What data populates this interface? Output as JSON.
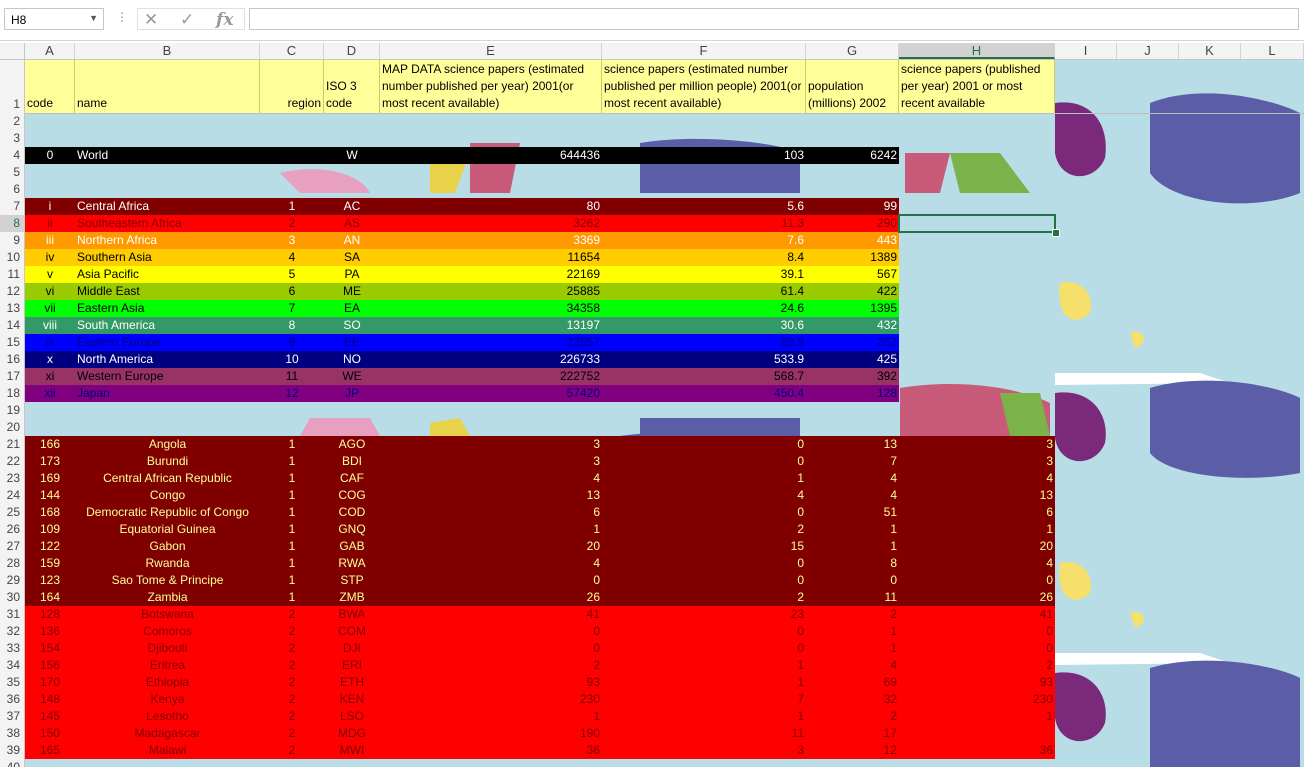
{
  "namebox": {
    "value": "H8"
  },
  "formula": {
    "value": ""
  },
  "columns": [
    "A",
    "B",
    "C",
    "D",
    "E",
    "F",
    "G",
    "H",
    "I",
    "J",
    "K",
    "L"
  ],
  "selected_column": "H",
  "selected_row": 8,
  "header_row": {
    "row": 1,
    "code": "code",
    "name": "name",
    "region": "region",
    "iso": "ISO 3 code",
    "map_data": "MAP DATA science papers (estimated number published per year) 2001(or most recent available)",
    "per_million": "science papers (estimated number published per million people) 2001(or most recent available)",
    "population": "population (millions) 2002",
    "papers": "science papers (published per year) 2001 or most recent available"
  },
  "world_row": {
    "row": 4,
    "code": "0",
    "name": "World",
    "iso": "W",
    "map_data": "644436",
    "per_million": "103",
    "population": "6242"
  },
  "regions": [
    {
      "row": 7,
      "code": "i",
      "name": "Central Africa",
      "region": "1",
      "iso": "AC",
      "map_data": "80",
      "per_million": "5.6",
      "population": "99",
      "bg": "#800000",
      "fg": "#ffffff"
    },
    {
      "row": 8,
      "code": "ii",
      "name": "Southeastern Africa",
      "region": "2",
      "iso": "AS",
      "map_data": "3262",
      "per_million": "11.3",
      "population": "290",
      "bg": "#ff0000",
      "fg": "#800000"
    },
    {
      "row": 9,
      "code": "iii",
      "name": "Northern Africa",
      "region": "3",
      "iso": "AN",
      "map_data": "3369",
      "per_million": "7.6",
      "population": "443",
      "bg": "#ff9900",
      "fg": "#ffffff"
    },
    {
      "row": 10,
      "code": "iv",
      "name": "Southern Asia",
      "region": "4",
      "iso": "SA",
      "map_data": "11654",
      "per_million": "8.4",
      "population": "1389",
      "bg": "#ffcc00",
      "fg": "#000000"
    },
    {
      "row": 11,
      "code": "v",
      "name": "Asia Pacific",
      "region": "5",
      "iso": "PA",
      "map_data": "22169",
      "per_million": "39.1",
      "population": "567",
      "bg": "#ffff00",
      "fg": "#000000"
    },
    {
      "row": 12,
      "code": "vi",
      "name": "Middle East",
      "region": "6",
      "iso": "ME",
      "map_data": "25885",
      "per_million": "61.4",
      "population": "422",
      "bg": "#99cc00",
      "fg": "#000000"
    },
    {
      "row": 13,
      "code": "vii",
      "name": "Eastern Asia",
      "region": "7",
      "iso": "EA",
      "map_data": "34358",
      "per_million": "24.6",
      "population": "1395",
      "bg": "#00ff00",
      "fg": "#000000"
    },
    {
      "row": 14,
      "code": "viii",
      "name": "South America",
      "region": "8",
      "iso": "SO",
      "map_data": "13197",
      "per_million": "30.6",
      "population": "432",
      "bg": "#339966",
      "fg": "#ffffff"
    },
    {
      "row": 15,
      "code": "ix",
      "name": "Eastern Europe",
      "region": "9",
      "iso": "EE",
      "map_data": "23557",
      "per_million": "89.9",
      "population": "262",
      "bg": "#0000ff",
      "fg": "#000080"
    },
    {
      "row": 16,
      "code": "x",
      "name": "North America",
      "region": "10",
      "iso": "NO",
      "map_data": "226733",
      "per_million": "533.9",
      "population": "425",
      "bg": "#000080",
      "fg": "#ffffff"
    },
    {
      "row": 17,
      "code": "xi",
      "name": "Western Europe",
      "region": "11",
      "iso": "WE",
      "map_data": "222752",
      "per_million": "568.7",
      "population": "392",
      "bg": "#993366",
      "fg": "#000000"
    },
    {
      "row": 18,
      "code": "xii",
      "name": "Japan",
      "region": "12",
      "iso": "JP",
      "map_data": "57420",
      "per_million": "450.4",
      "population": "128",
      "bg": "#800080",
      "fg": "#000080"
    }
  ],
  "countries": [
    {
      "row": 21,
      "code": "166",
      "name": "Angola",
      "region": "1",
      "iso": "AGO",
      "map_data": "3",
      "per_million": "0",
      "population": "13",
      "papers": "3",
      "group": 1
    },
    {
      "row": 22,
      "code": "173",
      "name": "Burundi",
      "region": "1",
      "iso": "BDI",
      "map_data": "3",
      "per_million": "0",
      "population": "7",
      "papers": "3",
      "group": 1
    },
    {
      "row": 23,
      "code": "169",
      "name": "Central African Republic",
      "region": "1",
      "iso": "CAF",
      "map_data": "4",
      "per_million": "1",
      "population": "4",
      "papers": "4",
      "group": 1
    },
    {
      "row": 24,
      "code": "144",
      "name": "Congo",
      "region": "1",
      "iso": "COG",
      "map_data": "13",
      "per_million": "4",
      "population": "4",
      "papers": "13",
      "group": 1
    },
    {
      "row": 25,
      "code": "168",
      "name": "Democratic Republic of Congo",
      "region": "1",
      "iso": "COD",
      "map_data": "6",
      "per_million": "0",
      "population": "51",
      "papers": "6",
      "group": 1
    },
    {
      "row": 26,
      "code": "109",
      "name": "Equatorial Guinea",
      "region": "1",
      "iso": "GNQ",
      "map_data": "1",
      "per_million": "2",
      "population": "1",
      "papers": "1",
      "group": 1
    },
    {
      "row": 27,
      "code": "122",
      "name": "Gabon",
      "region": "1",
      "iso": "GAB",
      "map_data": "20",
      "per_million": "15",
      "population": "1",
      "papers": "20",
      "group": 1
    },
    {
      "row": 28,
      "code": "159",
      "name": "Rwanda",
      "region": "1",
      "iso": "RWA",
      "map_data": "4",
      "per_million": "0",
      "population": "8",
      "papers": "4",
      "group": 1
    },
    {
      "row": 29,
      "code": "123",
      "name": "Sao Tome & Principe",
      "region": "1",
      "iso": "STP",
      "map_data": "0",
      "per_million": "0",
      "population": "0",
      "papers": "0",
      "group": 1
    },
    {
      "row": 30,
      "code": "164",
      "name": "Zambia",
      "region": "1",
      "iso": "ZMB",
      "map_data": "26",
      "per_million": "2",
      "population": "11",
      "papers": "26",
      "group": 1
    },
    {
      "row": 31,
      "code": "128",
      "name": "Botswana",
      "region": "2",
      "iso": "BWA",
      "map_data": "41",
      "per_million": "23",
      "population": "2",
      "papers": "41",
      "group": 2
    },
    {
      "row": 32,
      "code": "136",
      "name": "Comoros",
      "region": "2",
      "iso": "COM",
      "map_data": "0",
      "per_million": "0",
      "population": "1",
      "papers": "0",
      "group": 2
    },
    {
      "row": 33,
      "code": "154",
      "name": "Djibouti",
      "region": "2",
      "iso": "DJI",
      "map_data": "0",
      "per_million": "0",
      "population": "1",
      "papers": "0",
      "group": 2
    },
    {
      "row": 34,
      "code": "156",
      "name": "Eritrea",
      "region": "2",
      "iso": "ERI",
      "map_data": "2",
      "per_million": "1",
      "population": "4",
      "papers": "2",
      "group": 2
    },
    {
      "row": 35,
      "code": "170",
      "name": "Ethiopia",
      "region": "2",
      "iso": "ETH",
      "map_data": "93",
      "per_million": "1",
      "population": "69",
      "papers": "93",
      "group": 2
    },
    {
      "row": 36,
      "code": "148",
      "name": "Kenya",
      "region": "2",
      "iso": "KEN",
      "map_data": "230",
      "per_million": "7",
      "population": "32",
      "papers": "230",
      "group": 2
    },
    {
      "row": 37,
      "code": "145",
      "name": "Lesotho",
      "region": "2",
      "iso": "LSO",
      "map_data": "1",
      "per_million": "1",
      "population": "2",
      "papers": "1",
      "group": 2
    },
    {
      "row": 38,
      "code": "150",
      "name": "Madagascar",
      "region": "2",
      "iso": "MDG",
      "map_data": "190",
      "per_million": "11",
      "population": "17",
      "papers": "",
      "group": 2
    },
    {
      "row": 39,
      "code": "165",
      "name": "Malawi",
      "region": "2",
      "iso": "MWI",
      "map_data": "36",
      "per_million": "3",
      "population": "12",
      "papers": "36",
      "group": 2
    }
  ],
  "group_colors": {
    "1": {
      "bg": "#800000",
      "fg": "#ffff99"
    },
    "2": {
      "bg": "#ff0000",
      "fg": "#800000"
    }
  },
  "colors": {
    "world_bg": "#000000",
    "header_bg": "#ffff99",
    "ocean": "#b8dde6",
    "selection": "#217346"
  }
}
